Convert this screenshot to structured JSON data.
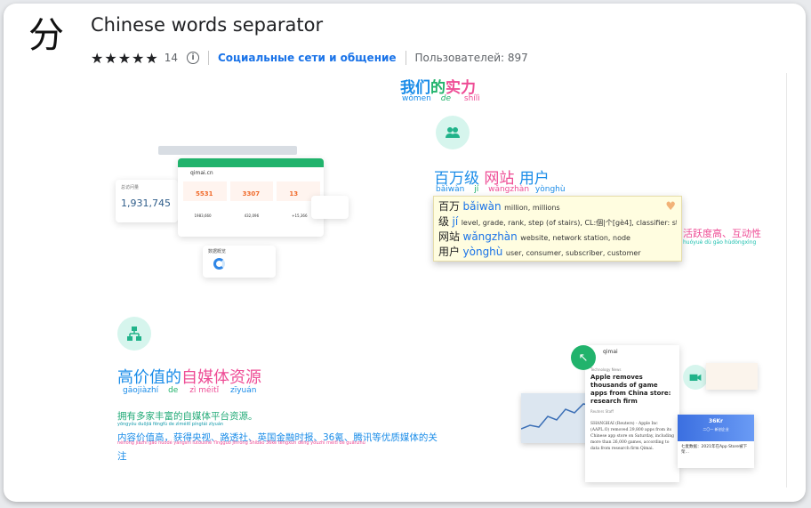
{
  "header": {
    "icon_char": "分",
    "title": "Chinese words separator",
    "stars": "★★★★★",
    "rating_count": "14",
    "info_icon": "i",
    "category": "Социальные сети и общение",
    "users": "Пользователей: 897"
  },
  "promo": {
    "heading1": {
      "hanzi": [
        "我们",
        "的",
        "实力"
      ],
      "pinyin": [
        "wǒmen",
        "de",
        "shílì"
      ]
    },
    "heading2": {
      "hanzi": [
        "百万级",
        "网站",
        "用户"
      ],
      "pinyin": [
        "bǎiwàn",
        "jí",
        "wǎngzhàn",
        "yònghù"
      ]
    },
    "heading3": {
      "hanzi": [
        "高价值的",
        "自媒体资源"
      ],
      "pinyin": [
        "gāojiàzhí",
        "de",
        "zì méitǐ",
        "zīyuán"
      ]
    },
    "tooltip": [
      {
        "word": "百万",
        "pinyin": "bǎiwàn",
        "def": "million, millions"
      },
      {
        "word": "级",
        "pinyin": "jí",
        "def": "level, grade, rank, step (of stairs), CL:個|个[gè4], classifier: step, level"
      },
      {
        "word": "网站",
        "pinyin": "wǎngzhàn",
        "def": "website, network station, node"
      },
      {
        "word": "用户",
        "pinyin": "yònghù",
        "def": "user, consumer, subscriber, customer"
      }
    ],
    "side_text": {
      "hanzi": "活跃度高、互动性",
      "pinyin": "huóyuè  dù  gāo    hùdòngxìng"
    },
    "body_line1": "拥有多家丰富的自媒体平台资源。",
    "body_line1_py": "yōngyǒu duōjiā fēngfù de zìméitǐ píngtái zīyuán",
    "body_line2": "内容价值高，获得央视、路透社、英国金融时报、36氪、腾讯等优质媒体的关注",
    "body_line2_py": "nèiróng jiàzhí gāo  huòdé yāngshì  lùtòushè  Yīngguó Jīnróng Shíbào  36kè  téngxùn děng yōuzhì méitǐ de guānzhù",
    "dashboard": {
      "site": "qimai.cn",
      "big_number": "1,931,745",
      "kpi": [
        "5531",
        "3307",
        "13"
      ],
      "table_vals": [
        "1983,660",
        "432,096",
        "+15,366"
      ],
      "label": "数据概览"
    },
    "news": {
      "source": "qimai",
      "outlet": "Technology News",
      "headline": "Apple removes thousands of game apps from China store: research firm",
      "byline": "Reuters Staff",
      "body": "SHANGHAI (Reuters) - Apple Inc (AAPL.O) removed 29,800 apps from its Chinese app store on Saturday, including more than 26,000 games, according to data from research firm Qimai.",
      "kr_badge": "36Kr",
      "kr_caption": "七麦数据：2021年在App Store被下架…",
      "kr_sub": "二〇一 新创企业"
    }
  }
}
